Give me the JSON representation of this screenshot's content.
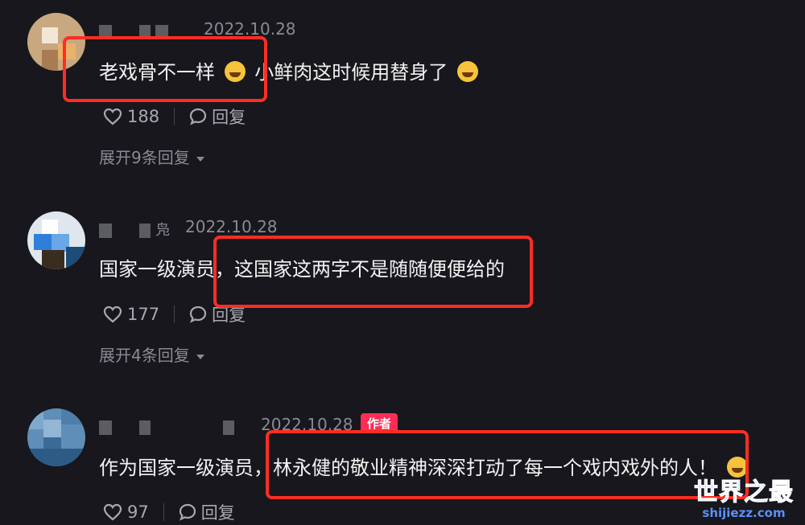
{
  "comments": [
    {
      "date": "2022.10.28",
      "text_before": "老戏骨不一样",
      "text_after": "小鲜肉这时候用替身了",
      "likes": "188",
      "reply_label": "回复",
      "expand_label": "展开9条回复"
    },
    {
      "date": "2022.10.28",
      "username_fragment": "凫",
      "text": "国家一级演员，这国家这两字不是随随便便给的",
      "likes": "177",
      "reply_label": "回复",
      "expand_label": "展开4条回复"
    },
    {
      "date": "2022.10.28",
      "author_badge": "作者",
      "text": "作为国家一级演员，林永健的敬业精神深深打动了每一个戏内戏外的人！",
      "likes": "97",
      "reply_label": "回复"
    }
  ],
  "watermark": {
    "main": "世界之最",
    "sub": "shijiezz.com"
  },
  "colors": {
    "background": "#17171d",
    "highlight_box": "#ff2d22",
    "author_badge": "#fe2c55",
    "watermark": "#5b8ff9"
  }
}
